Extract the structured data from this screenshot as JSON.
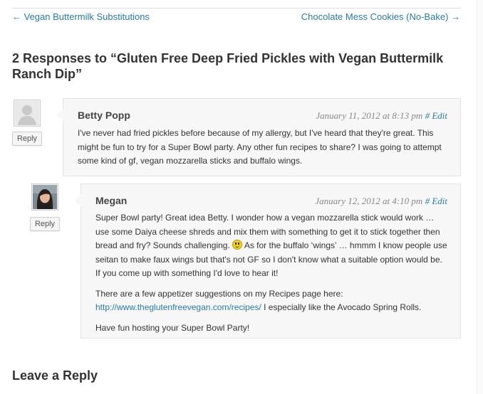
{
  "navigation": {
    "previous": "← Vegan Buttermilk Substitutions",
    "next": "Chocolate Mess Cookies (No-Bake) →"
  },
  "responses_title": "2 Responses to “Gluten Free Deep Fried Pickles with Vegan Buttermilk Ranch Dip”",
  "reply_label": "Reply",
  "comments": [
    {
      "author": "Betty Popp",
      "date": "January 11, 2012 at 8:13 pm",
      "permalink": "#",
      "edit": "Edit",
      "paragraphs": [
        "I've never had fried pickles before because of my allergy, but I've heard that they're great. This might be fun to try for a Super Bowl party. Any other fun recipes to share? I was going to attempt some kind of gf, vegan mozzarella sticks and buffalo wings."
      ]
    },
    {
      "author": "Megan",
      "date": "January 12, 2012 at 4:10 pm",
      "permalink": "#",
      "edit": "Edit",
      "p1_before": "Super Bowl party! Great idea Betty. I wonder how a vegan mozzarella stick would work … use some Daiya cheese shreds and mix them with something to get it to stick together then bread and fry? Sounds challenging.",
      "p1_after": "As for the buffalo ‘wings’ … hmmm I know people use seitan to make faux wings but that's not GF so I don't know what a suitable option would be. If you come up with something I'd love to hear it!",
      "p2_before": "There are a few appetizer suggestions on my Recipes page here:",
      "p2_link": "http://www.theglutenfreevegan.com/recipes/",
      "p2_after": "I especially like the Avocado Spring Rolls.",
      "p3": "Have fun hosting your Super Bowl Party!"
    }
  ],
  "leave_reply": "Leave a Reply",
  "icons": {
    "default_avatar": "person-silhouette-icon",
    "megan_avatar": "user-photo-avatar",
    "smiley": "smiley-emoticon-icon"
  },
  "colors": {
    "link": "#2a7aa6",
    "comment_bg": "#f7f7f7",
    "meta": "#888888"
  }
}
